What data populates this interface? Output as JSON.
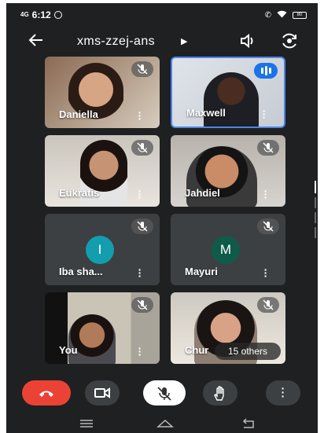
{
  "status": {
    "time": "6:12",
    "network": "4G",
    "battery": "80"
  },
  "header": {
    "meeting_code": "xms-zzej-ans"
  },
  "tiles": [
    {
      "name": "Daniella"
    },
    {
      "name": "Maxwell"
    },
    {
      "name": "Eukratis"
    },
    {
      "name": "Jahdiel"
    },
    {
      "name": "Iba sha...",
      "initial": "I",
      "avatar_color": "#129eaf"
    },
    {
      "name": "Mayuri",
      "initial": "M",
      "avatar_color": "#0f5b4a"
    },
    {
      "name": "You"
    },
    {
      "name": "Chur"
    }
  ],
  "others": {
    "label": "15 others"
  },
  "colors": {
    "end_call": "#ea4335",
    "speaking_accent": "#1a73e8",
    "background": "#1f2022"
  },
  "icons": [
    "back-arrow-icon",
    "speaker-icon",
    "switch-camera-icon",
    "mic-off-icon",
    "more-vert-icon",
    "end-call-icon",
    "video-icon",
    "hand-icon"
  ]
}
